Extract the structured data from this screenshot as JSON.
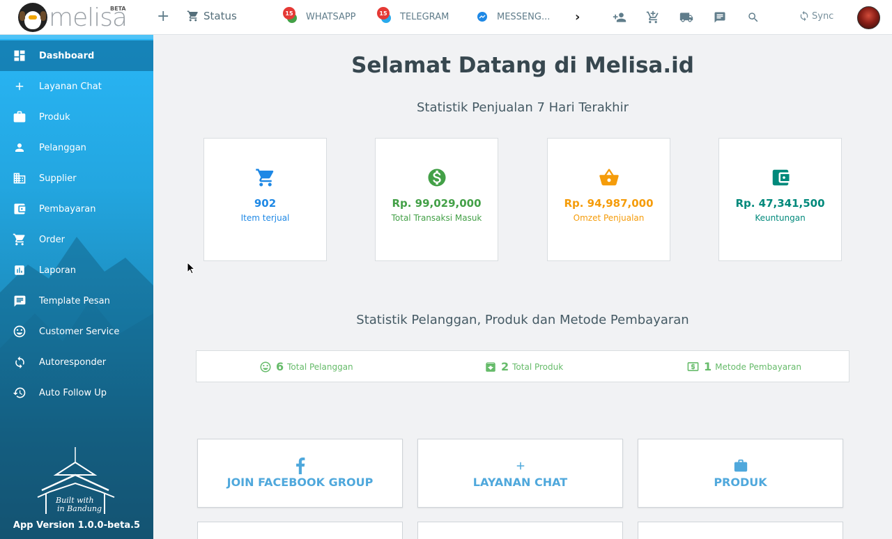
{
  "header": {
    "logo_text": "melisa",
    "beta_label": "BETA",
    "status_label": "Status",
    "channels": [
      {
        "name": "WHATSAPP",
        "badge": "15",
        "icon": "whatsapp-icon",
        "color": "#43a047"
      },
      {
        "name": "TELEGRAM",
        "badge": "15",
        "icon": "telegram-icon",
        "color": "#29a9eb"
      },
      {
        "name": "MESSENG...",
        "badge": "",
        "icon": "messenger-icon",
        "color": "#1e88e5"
      }
    ],
    "sync_label": "Sync"
  },
  "sidebar": {
    "items": [
      {
        "label": "Dashboard",
        "icon": "dashboard-icon",
        "active": true
      },
      {
        "label": "Layanan Chat",
        "icon": "plus-icon"
      },
      {
        "label": "Produk",
        "icon": "briefcase-icon"
      },
      {
        "label": "Pelanggan",
        "icon": "person-icon"
      },
      {
        "label": "Supplier",
        "icon": "building-icon"
      },
      {
        "label": "Pembayaran",
        "icon": "wallet-icon"
      },
      {
        "label": "Order",
        "icon": "cart-icon"
      },
      {
        "label": "Laporan",
        "icon": "bar-chart-icon"
      },
      {
        "label": "Template Pesan",
        "icon": "message-icon"
      },
      {
        "label": "Customer Service",
        "icon": "smiley-icon"
      },
      {
        "label": "Autoresponder",
        "icon": "refresh-icon"
      },
      {
        "label": "Auto Follow Up",
        "icon": "history-icon"
      }
    ],
    "footer_art_text_1": "Built with",
    "footer_art_text_2": "in Bandung",
    "version": "App Version 1.0.0-beta.5"
  },
  "main": {
    "title": "Selamat Datang di Melisa.id",
    "sales_title": "Statistik Penjualan 7 Hari Terakhir",
    "stats": [
      {
        "value": "902",
        "label": "Item terjual",
        "icon": "cart-icon",
        "color": "#1e88e5"
      },
      {
        "value": "Rp. 99,029,000",
        "label": "Total Transaksi Masuk",
        "icon": "dollar-icon",
        "color": "#43a047"
      },
      {
        "value": "Rp. 94,987,000",
        "label": "Omzet Penjualan",
        "icon": "basket-icon",
        "color": "#f59c0a"
      },
      {
        "value": "Rp. 47,341,500",
        "label": "Keuntungan",
        "icon": "wallet-icon",
        "color": "#00897b"
      }
    ],
    "summary_title": "Statistik Pelanggan, Produk dan Metode Pembayaran",
    "summary": [
      {
        "count": "6",
        "label": "Total Pelanggan",
        "icon": "smiley-icon"
      },
      {
        "count": "2",
        "label": "Total Produk",
        "icon": "archive-icon"
      },
      {
        "count": "1",
        "label": "Metode Pembayaran",
        "icon": "money-icon"
      }
    ],
    "tiles": [
      {
        "label": "JOIN FACEBOOK GROUP",
        "icon": "facebook-icon"
      },
      {
        "label": "LAYANAN CHAT",
        "icon": "plus-icon"
      },
      {
        "label": "PRODUK",
        "icon": "briefcase-icon"
      }
    ]
  }
}
